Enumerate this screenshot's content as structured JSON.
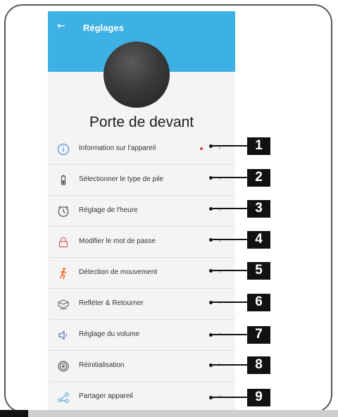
{
  "appbar": {
    "back_icon": "arrow-left-icon",
    "title": "Réglages"
  },
  "device": {
    "name": "Porte de devant"
  },
  "menu": {
    "items": [
      {
        "label": "Information sur l'appareil",
        "icon": "info-icon",
        "badge": true
      },
      {
        "label": "Sélectionner le type de pile",
        "icon": "battery-icon"
      },
      {
        "label": "Réglage de l'heure",
        "icon": "clock-icon"
      },
      {
        "label": "Modifier le mot de passe",
        "icon": "lock-icon"
      },
      {
        "label": "Détection de mouvement",
        "icon": "motion-icon"
      },
      {
        "label": "Refléter & Retourner",
        "icon": "flip-icon"
      },
      {
        "label": "Réglage du volume",
        "icon": "speaker-icon"
      },
      {
        "label": "Réinitialisation",
        "icon": "reset-icon"
      },
      {
        "label": "Partager appareil",
        "icon": "share-icon"
      }
    ]
  },
  "callouts": [
    "1",
    "2",
    "3",
    "4",
    "5",
    "6",
    "7",
    "8",
    "9"
  ],
  "colors": {
    "appbar": "#3db1e4",
    "badge": "#e53935",
    "motion": "#f26522",
    "lock": "#e05a6a"
  }
}
